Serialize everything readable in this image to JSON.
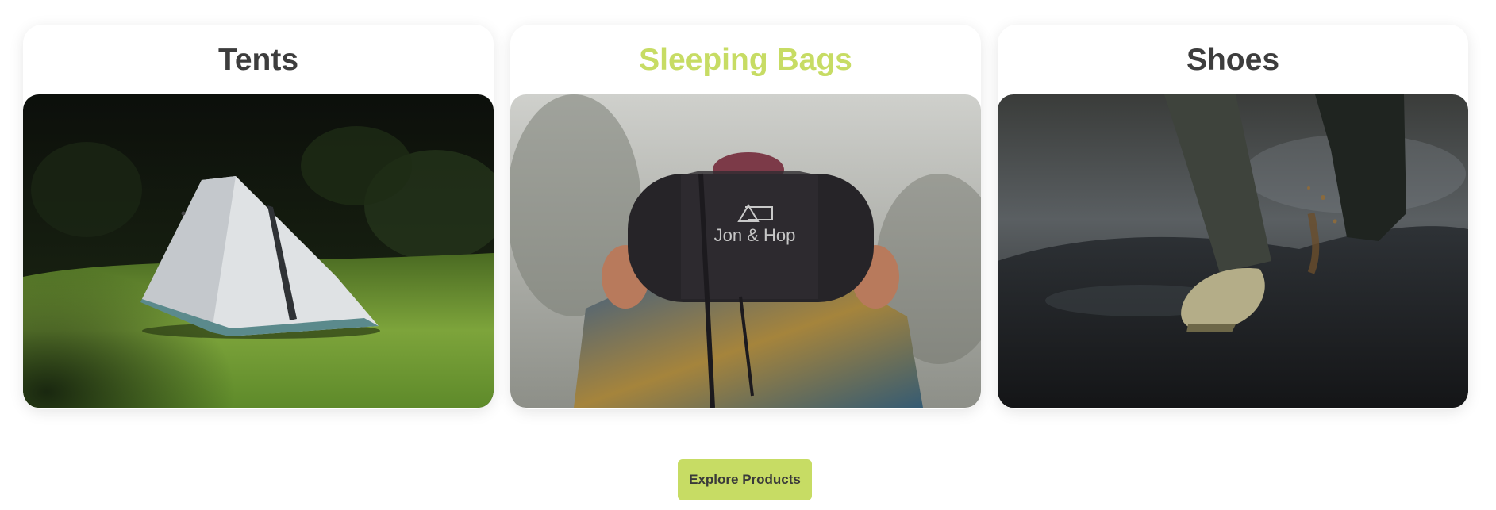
{
  "categories": [
    {
      "title": "Tents",
      "image": "tent-in-forest-clearing"
    },
    {
      "title": "Sleeping Bags",
      "image": "person-holding-sleeping-bag",
      "bag_label": "Jon & Hop"
    },
    {
      "title": "Shoes",
      "image": "hiking-shoes-in-mud"
    }
  ],
  "cta": {
    "label": "Explore Products"
  },
  "colors": {
    "accent": "#c7dc64",
    "title": "#3d3d3d",
    "background": "#ffffff"
  }
}
